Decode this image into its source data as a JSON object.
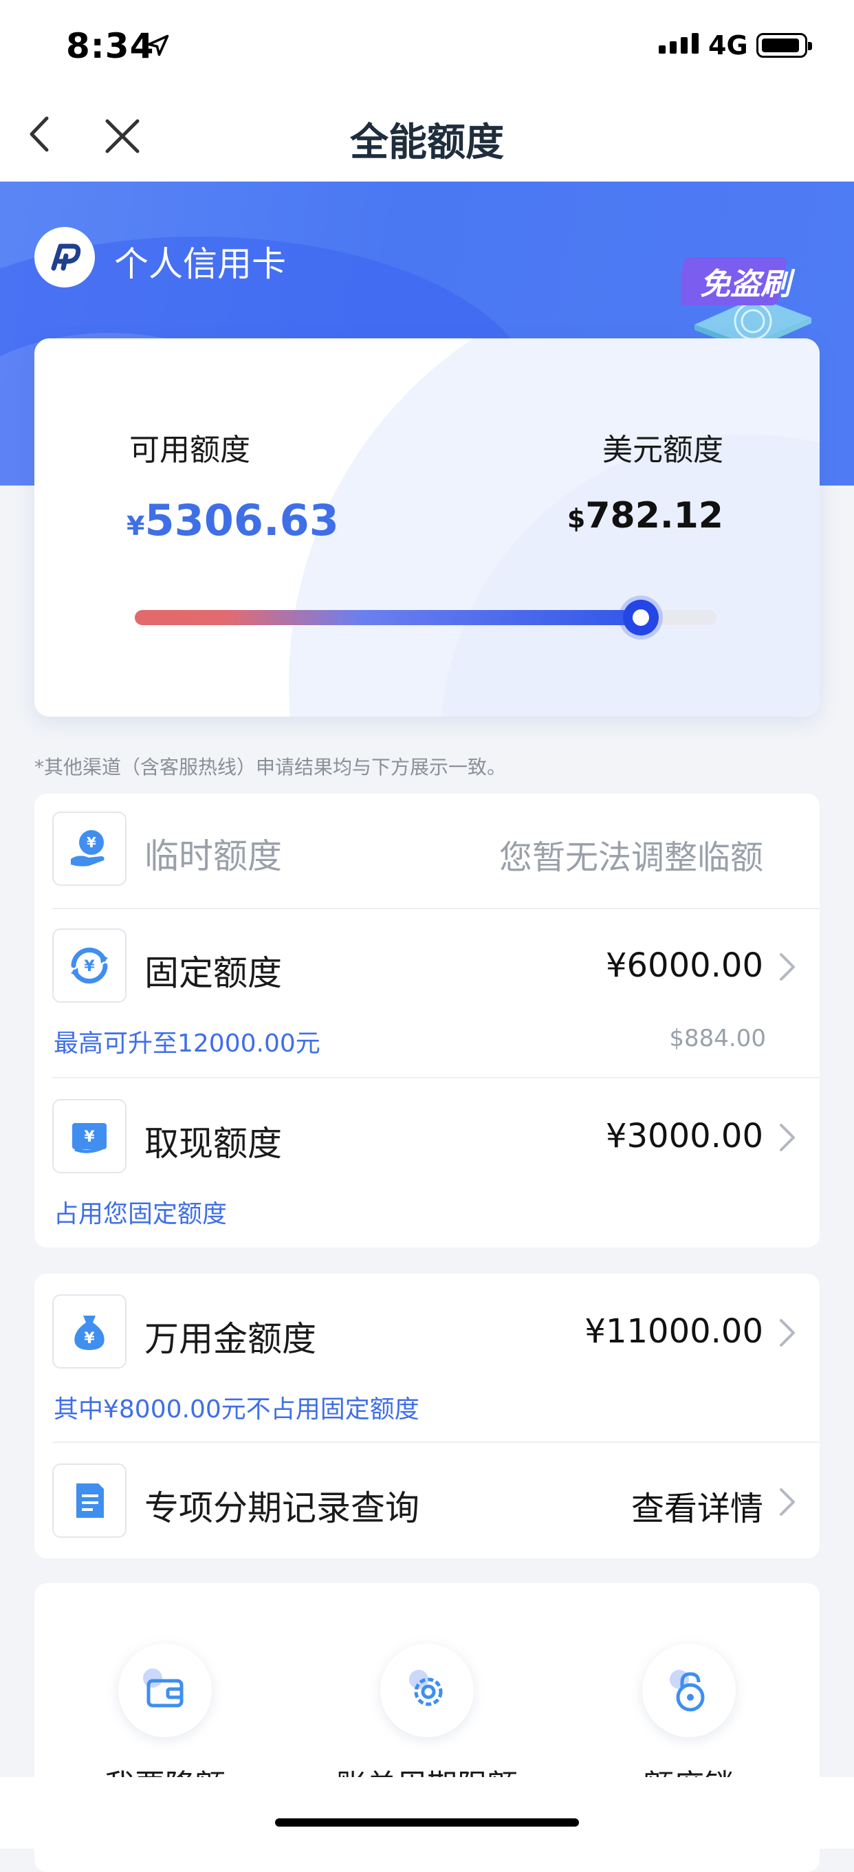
{
  "status_bar": {
    "time": "8:34",
    "network": "4G"
  },
  "nav": {
    "title": "全能额度"
  },
  "header": {
    "brand_name": "个人信用卡",
    "badge_text": "免盗刷"
  },
  "limit_card": {
    "available_label": "可用额度",
    "available_currency": "¥",
    "available_value": "5306.63",
    "usd_label": "美元额度",
    "usd_currency": "$",
    "usd_value": "782.12",
    "slider_fraction": 0.87
  },
  "notice": "*其他渠道（含客服热线）申请结果均与下方展示一致。",
  "rows": {
    "temp": {
      "title": "临时额度",
      "value": "您暂无法调整临额"
    },
    "fixed": {
      "title": "固定额度",
      "value": "¥6000.00",
      "sub": "最高可升至12000.00元",
      "sub_right": "$884.00"
    },
    "cash": {
      "title": "取现额度",
      "value": "¥3000.00",
      "sub": "占用您固定额度"
    },
    "universal": {
      "title": "万用金额度",
      "value": "¥11000.00",
      "sub": "其中¥8000.00元不占用固定额度"
    },
    "installment": {
      "title": "专项分期记录查询",
      "value": "查看详情"
    }
  },
  "quick_actions": [
    {
      "label": "我要降额",
      "icon": "wallet-icon"
    },
    {
      "label": "账单周期限额",
      "icon": "gear-icon"
    },
    {
      "label": "额度锁",
      "icon": "lock-icon"
    }
  ],
  "colors": {
    "accent": "#3f6fe6",
    "header_blue": "#4a78f3",
    "slider_red": "#e26a6a"
  }
}
